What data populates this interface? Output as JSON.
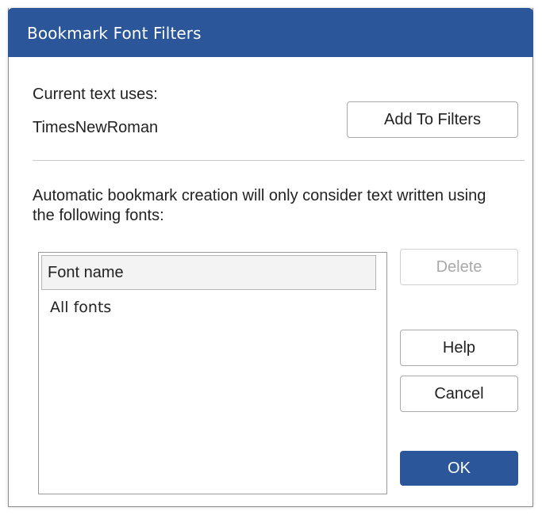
{
  "dialog": {
    "title": "Bookmark Font Filters",
    "accent_color": "#2b579a",
    "current_text_label": "Current text uses:",
    "current_font": "TimesNewRoman",
    "add_to_filters_label": "Add To Filters",
    "description_line1": "Automatic bookmark creation will only consider text written using",
    "description_line2": "the following fonts:",
    "fonts_list": {
      "column_header": "Font name",
      "items": [
        "All fonts"
      ]
    },
    "buttons": {
      "delete_label": "Delete",
      "delete_enabled": false,
      "help_label": "Help",
      "cancel_label": "Cancel",
      "ok_label": "OK"
    }
  }
}
